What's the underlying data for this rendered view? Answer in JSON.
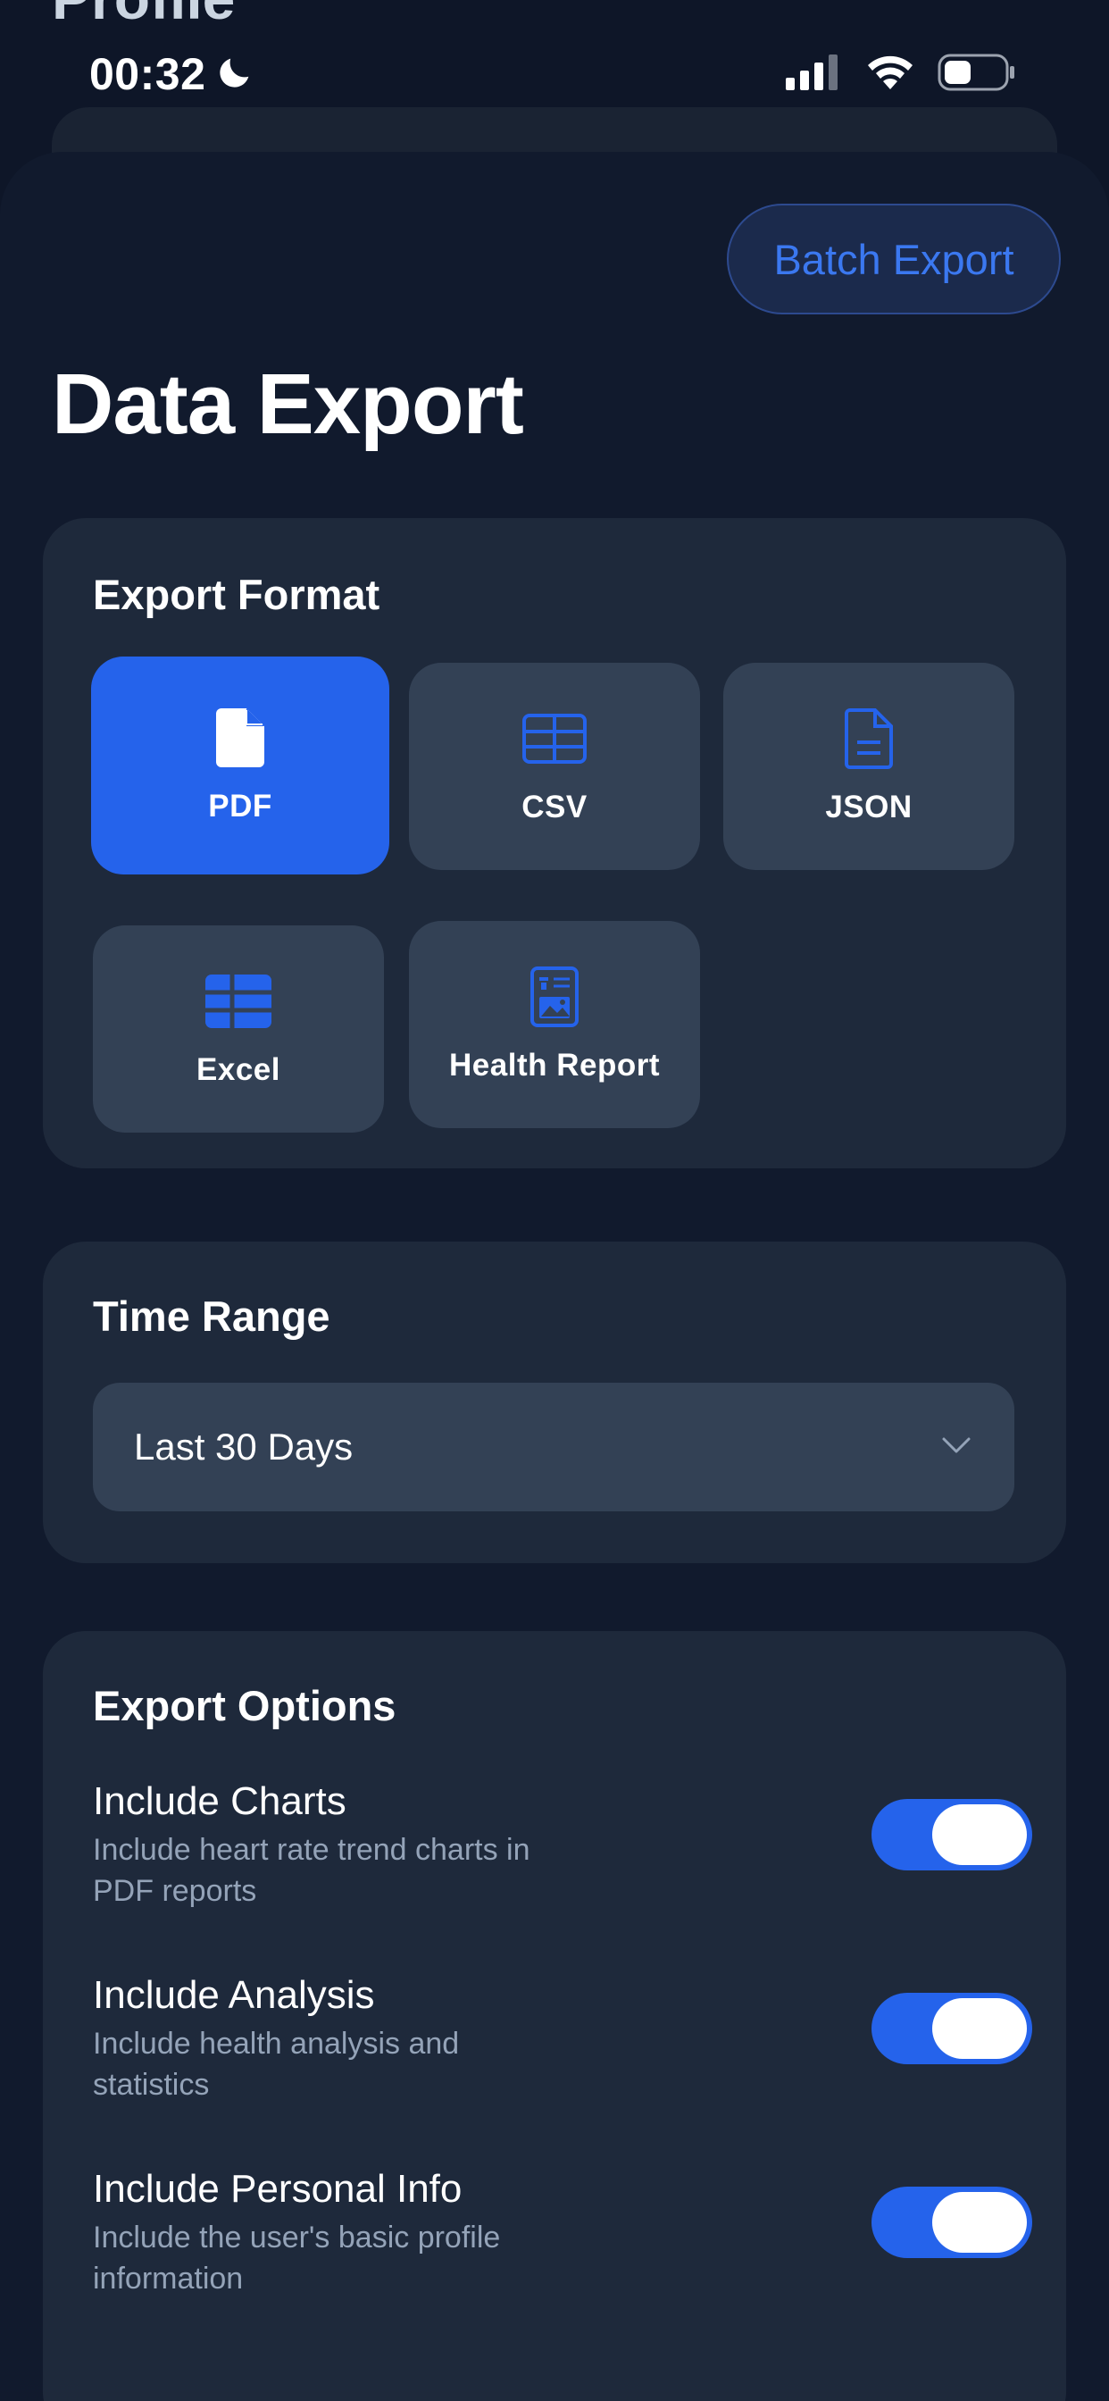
{
  "background": {
    "title": "Profile"
  },
  "status_bar": {
    "time": "00:32",
    "battery_level": 0.45
  },
  "header": {
    "batch_export_label": "Batch Export",
    "title": "Data Export"
  },
  "export_format": {
    "title": "Export Format",
    "selected": "PDF",
    "options": [
      {
        "label": "PDF",
        "icon": "file-icon"
      },
      {
        "label": "CSV",
        "icon": "table-icon"
      },
      {
        "label": "JSON",
        "icon": "document-icon"
      },
      {
        "label": "Excel",
        "icon": "spreadsheet-icon"
      },
      {
        "label": "Health Report",
        "icon": "report-icon"
      }
    ]
  },
  "time_range": {
    "title": "Time Range",
    "selected": "Last 30 Days"
  },
  "export_options": {
    "title": "Export Options",
    "items": [
      {
        "title": "Include Charts",
        "description": "Include heart rate trend charts in PDF reports",
        "enabled": true
      },
      {
        "title": "Include Analysis",
        "description": "Include health analysis and statistics",
        "enabled": true
      },
      {
        "title": "Include Personal Info",
        "description": "Include the user's basic profile information",
        "enabled": true
      }
    ]
  },
  "colors": {
    "accent": "#2563eb",
    "card": "#1e293b",
    "tile": "#334155",
    "sheet": "#111a2d"
  }
}
